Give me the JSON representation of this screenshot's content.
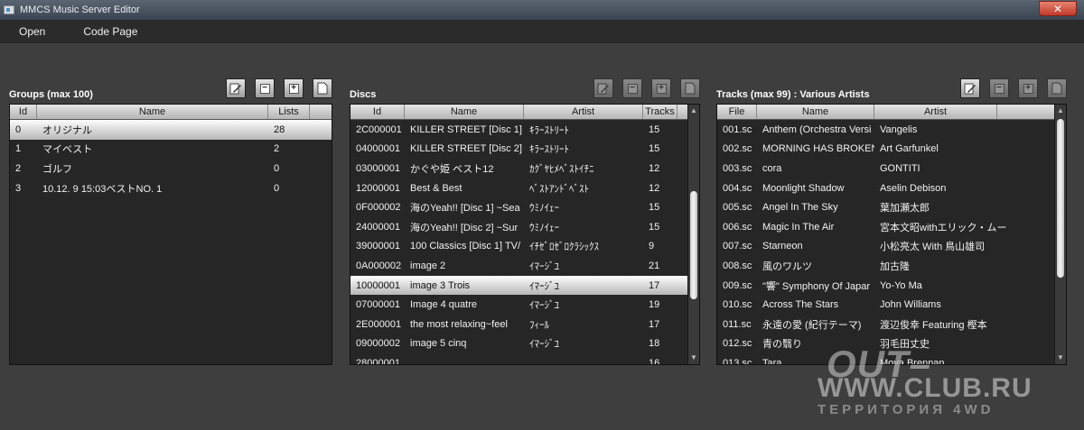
{
  "window": {
    "title": "MMCS Music Server Editor",
    "close_glyph": "✕"
  },
  "menu": [
    "Open",
    "Code Page"
  ],
  "groups": {
    "title": "Groups (max 100)",
    "columns": [
      "Id",
      "Name",
      "Lists"
    ],
    "rows": [
      [
        "0",
        "オリジナル",
        "28"
      ],
      [
        "1",
        "マイベスト",
        "2"
      ],
      [
        "2",
        "ゴルフ",
        "0"
      ],
      [
        "3",
        "10.12. 9 15:03ベストNO. 1",
        "0"
      ]
    ],
    "selected_index": 0
  },
  "discs": {
    "title": "Discs",
    "columns": [
      "Id",
      "Name",
      "Artist",
      "Tracks"
    ],
    "rows": [
      [
        "2C000001",
        "KILLER STREET [Disc 1]",
        "ｷﾗｰｽﾄﾘｰﾄ",
        "15"
      ],
      [
        "04000001",
        "KILLER STREET [Disc 2]",
        "ｷﾗｰｽﾄﾘｰﾄ",
        "15"
      ],
      [
        "03000001",
        "かぐや姫 ベスト12",
        "ｶｸﾞﾔﾋﾒﾍﾞｽﾄｲﾁﾆ",
        "12"
      ],
      [
        "12000001",
        "Best & Best",
        "ﾍﾞｽﾄｱﾝﾄﾞﾍﾞｽﾄ",
        "12"
      ],
      [
        "0F000002",
        "海のYeah!! [Disc 1] ~Sea",
        "ｳﾐﾉｲｪｰ",
        "15"
      ],
      [
        "24000001",
        "海のYeah!! [Disc 2] ~Sur",
        "ｳﾐﾉｲｪｰ",
        "15"
      ],
      [
        "39000001",
        "100 Classics [Disc 1] TV/",
        "ｲﾁｾﾞﾛｾﾞﾛｸﾗｼｯｸｽ",
        "9"
      ],
      [
        "0A000002",
        "image 2",
        "ｲﾏｰｼﾞﾕ",
        "21"
      ],
      [
        "10000001",
        "image 3 Trois",
        "ｲﾏｰｼﾞﾕ",
        "17"
      ],
      [
        "07000001",
        "Image 4 quatre",
        "ｲﾏｰｼﾞﾕ",
        "19"
      ],
      [
        "2E000001",
        "the most relaxing~feel",
        "ﾌｨｰﾙ",
        "17"
      ],
      [
        "09000002",
        "image 5 cinq",
        "ｲﾏｰｼﾞﾕ",
        "18"
      ],
      [
        "28000001",
        "",
        "",
        "16"
      ]
    ],
    "selected_index": 8
  },
  "tracks": {
    "title": "Tracks (max 99) : Various Artists",
    "columns": [
      "File",
      "Name",
      "Artist"
    ],
    "rows": [
      [
        "001.sc",
        "Anthem (Orchestra Versi",
        "Vangelis"
      ],
      [
        "002.sc",
        "MORNING HAS BROKEN",
        "Art Garfunkel"
      ],
      [
        "003.sc",
        "cora",
        "GONTITI"
      ],
      [
        "004.sc",
        "Moonlight Shadow",
        "Aselin Debison"
      ],
      [
        "005.sc",
        "Angel In The Sky",
        "葉加瀬太郎"
      ],
      [
        "006.sc",
        "Magic In The Air",
        "宮本文昭withエリック・ムー"
      ],
      [
        "007.sc",
        "Starneon",
        "小松亮太 With 鳥山雄司"
      ],
      [
        "008.sc",
        "風のワルツ",
        "加古隆"
      ],
      [
        "009.sc",
        "\"響\" Symphony Of Japar",
        "Yo-Yo Ma"
      ],
      [
        "010.sc",
        "Across The Stars",
        "John Williams"
      ],
      [
        "011.sc",
        "永遠の愛 (紀行テーマ)",
        "渡辺俊幸 Featuring 樫本"
      ],
      [
        "012.sc",
        "青の翳り",
        "羽毛田丈史"
      ],
      [
        "013.sc",
        "Tara",
        "Moya Brennan"
      ]
    ]
  },
  "watermark": {
    "line1": "OUT–",
    "line2": "WWW.CLUB.RU",
    "line3": "ТЕРРИТОРИЯ 4WD"
  }
}
